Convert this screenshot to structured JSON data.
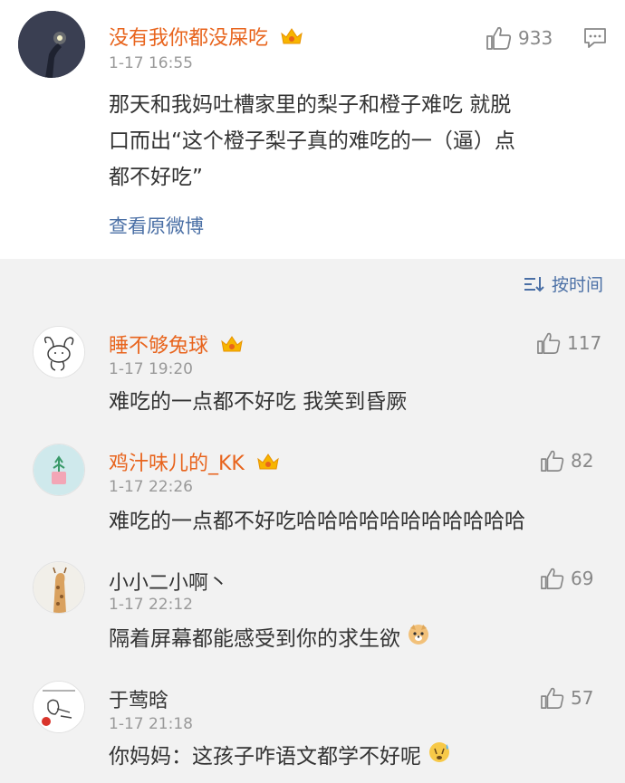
{
  "main_post": {
    "username": "没有我你都没屎吃",
    "time": "1-17 16:55",
    "likes": "933",
    "content_lines": [
      "那天和我妈吐槽家里的梨子和橙子难吃 就脱",
      "口而出“这个橙子梨子真的难吃的一（逼）点",
      "都不好吃”"
    ],
    "view_original": "查看原微博"
  },
  "sort": {
    "label": "按时间"
  },
  "comments": [
    {
      "username": "睡不够兔球",
      "time": "1-17 19:20",
      "likes": "117",
      "text": "难吃的一点都不好吃 我笑到昏厥"
    },
    {
      "username": "鸡汁味儿的_KK",
      "time": "1-17 22:26",
      "likes": "82",
      "text": "难吃的一点都不好吃哈哈哈哈哈哈哈哈哈哈哈"
    },
    {
      "username": "小小二小啊丶",
      "time": "1-17 22:12",
      "likes": "69",
      "text": "隔着屏幕都能感受到你的求生欲"
    },
    {
      "username": "于莺晗",
      "time": "1-17 21:18",
      "likes": "57",
      "text": "你妈妈：这孩子咋语文都学不好呢"
    }
  ],
  "colors": {
    "username_vip": "#e8641d",
    "link": "#4a6fa5",
    "meta": "#999999"
  }
}
